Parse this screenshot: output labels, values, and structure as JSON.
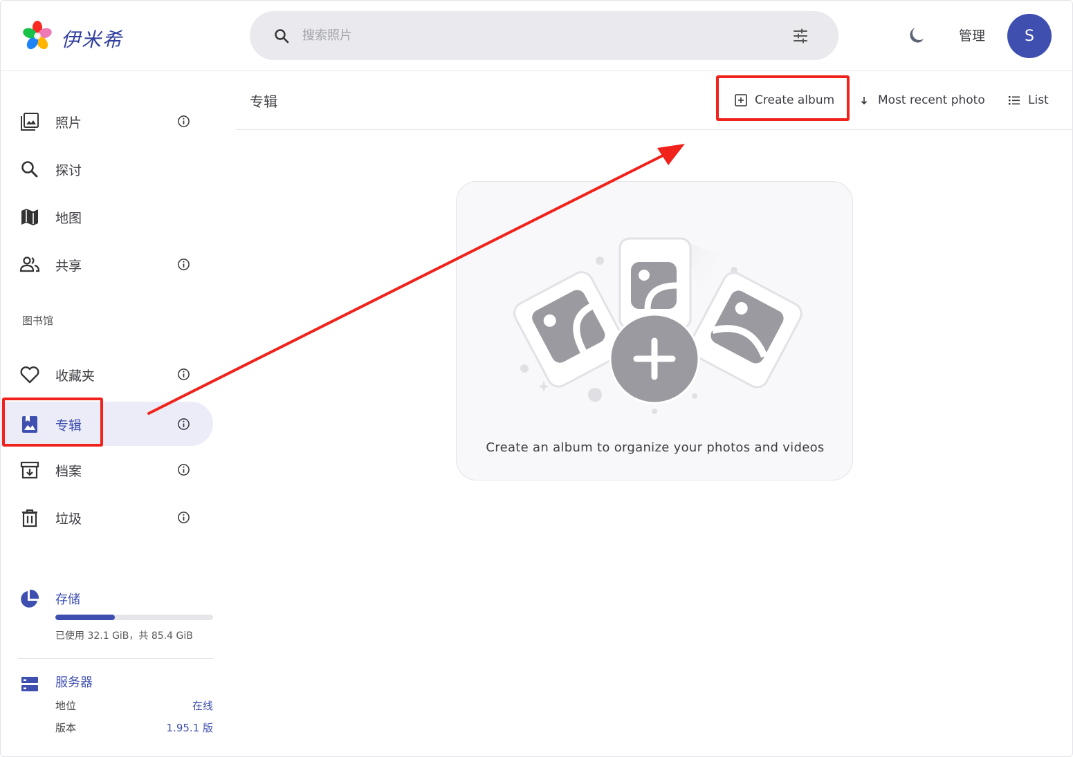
{
  "header": {
    "brand": "伊米希",
    "search_placeholder": "搜索照片",
    "admin_label": "管理",
    "avatar_initial": "S"
  },
  "sidebar": {
    "items": [
      {
        "label": "照片",
        "icon": "photo-library-icon",
        "info": true
      },
      {
        "label": "探讨",
        "icon": "search-icon",
        "info": false
      },
      {
        "label": "地图",
        "icon": "map-icon",
        "info": false
      },
      {
        "label": "共享",
        "icon": "people-icon",
        "info": true
      },
      {
        "label": "收藏夹",
        "icon": "heart-icon",
        "info": true
      },
      {
        "label": "专辑",
        "icon": "album-icon",
        "info": true,
        "active": true
      },
      {
        "label": "档案",
        "icon": "archive-icon",
        "info": true
      },
      {
        "label": "垃圾",
        "icon": "trash-icon",
        "info": true
      }
    ],
    "section_label": "图书馆",
    "storage": {
      "title": "存储",
      "usage_text": "已使用 32.1 GiB，共 85.4 GiB",
      "used_fraction": 0.376
    },
    "server": {
      "title": "服务器",
      "rows": [
        {
          "label": "地位",
          "value": "在线"
        },
        {
          "label": "版本",
          "value": "1.95.1 版"
        }
      ]
    }
  },
  "toolbar": {
    "title": "专辑",
    "create_label": "Create album",
    "sort_label": "Most recent photo",
    "view_label": "List"
  },
  "empty_state": {
    "message": "Create an album to organize your photos and videos"
  },
  "colors": {
    "accent": "#3e4fb0",
    "highlight": "#f0221b"
  }
}
